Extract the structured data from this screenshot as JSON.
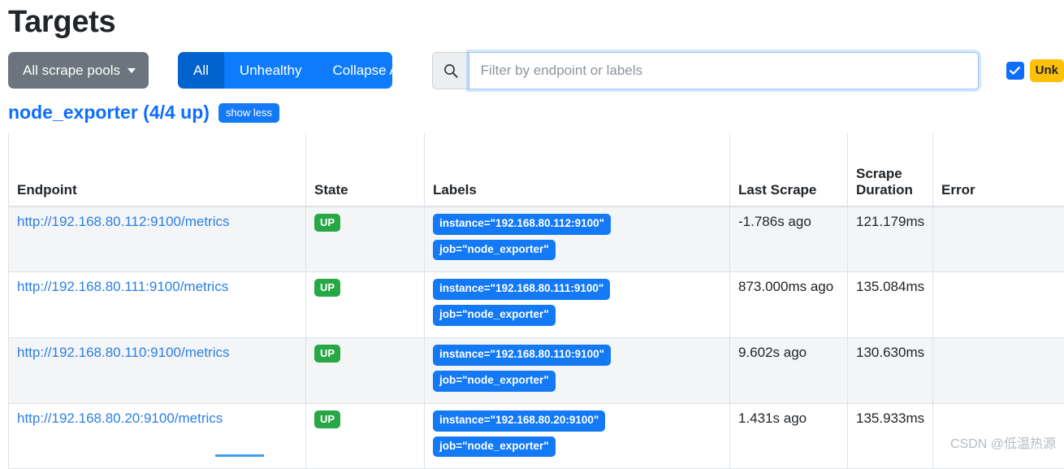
{
  "header": {
    "title": "Targets"
  },
  "toolbar": {
    "scrape_pool_label": "All scrape pools",
    "caret_icon": "chevron-down-icon",
    "filters": [
      {
        "label": "All",
        "active": true
      },
      {
        "label": "Unhealthy",
        "active": false
      },
      {
        "label": "Collapse All",
        "active": false
      }
    ],
    "search": {
      "icon": "search-icon",
      "placeholder": "Filter by endpoint or labels",
      "value": ""
    },
    "unknown_toggle": {
      "checked": true,
      "check_icon": "check-icon",
      "label": "Unk"
    }
  },
  "job": {
    "title": "node_exporter (4/4 up)",
    "show_less_label": "show less"
  },
  "table": {
    "columns": [
      "Endpoint",
      "State",
      "Labels",
      "Last Scrape",
      "Scrape Duration",
      "Error"
    ],
    "rows": [
      {
        "endpoint": "http://192.168.80.112:9100/metrics",
        "state": "UP",
        "labels": [
          "instance=\"192.168.80.112:9100\"",
          "job=\"node_exporter\""
        ],
        "last_scrape": "-1.786s ago",
        "scrape_duration": "121.179ms",
        "error": ""
      },
      {
        "endpoint": "http://192.168.80.111:9100/metrics",
        "state": "UP",
        "labels": [
          "instance=\"192.168.80.111:9100\"",
          "job=\"node_exporter\""
        ],
        "last_scrape": "873.000ms ago",
        "scrape_duration": "135.084ms",
        "error": ""
      },
      {
        "endpoint": "http://192.168.80.110:9100/metrics",
        "state": "UP",
        "labels": [
          "instance=\"192.168.80.110:9100\"",
          "job=\"node_exporter\""
        ],
        "last_scrape": "9.602s ago",
        "scrape_duration": "130.630ms",
        "error": ""
      },
      {
        "endpoint": "http://192.168.80.20:9100/metrics",
        "state": "UP",
        "labels": [
          "instance=\"192.168.80.20:9100\"",
          "job=\"node_exporter\""
        ],
        "last_scrape": "1.431s ago",
        "scrape_duration": "135.933ms",
        "error": ""
      }
    ]
  },
  "watermark": "CSDN @低温热源",
  "colors": {
    "primary": "#0d6efd",
    "primary_active": "#0062cc",
    "secondary": "#6c757d",
    "success": "#28a745",
    "warning": "#ffc107",
    "link": "#2a7fe8",
    "stripe": "#f4f5f6",
    "border": "#dee2e6"
  }
}
